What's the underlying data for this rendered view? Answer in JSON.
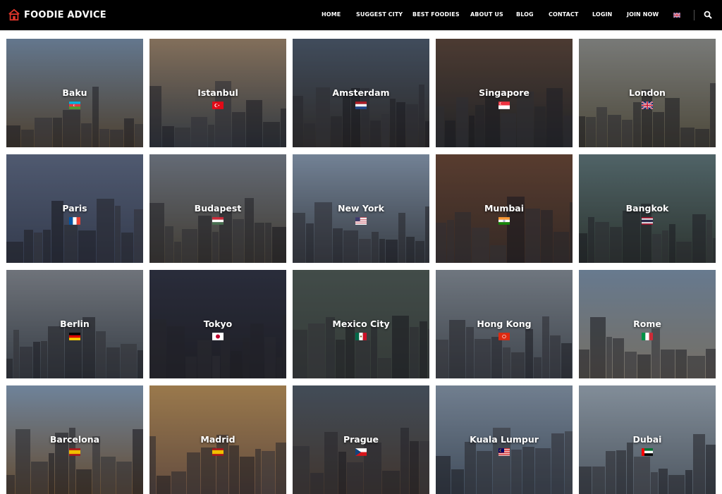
{
  "brand": {
    "name": "FOODIE ADVICE",
    "icon": "chef-house-icon",
    "color": "#e0362b"
  },
  "nav": {
    "items": [
      {
        "label": "HOME"
      },
      {
        "label": "SUGGEST CITY"
      },
      {
        "label": "BEST FOODIES"
      },
      {
        "label": "ABOUT US"
      },
      {
        "label": "BLOG"
      },
      {
        "label": "CONTACT"
      },
      {
        "label": "LOGIN"
      },
      {
        "label": "JOIN NOW"
      }
    ],
    "language_flag": "uk-flag-icon",
    "search_icon": "search-icon"
  },
  "cities": [
    {
      "name": "Baku",
      "flag": "azerbaijan"
    },
    {
      "name": "Istanbul",
      "flag": "turkey"
    },
    {
      "name": "Amsterdam",
      "flag": "netherlands"
    },
    {
      "name": "Singapore",
      "flag": "singapore"
    },
    {
      "name": "London",
      "flag": "uk"
    },
    {
      "name": "Paris",
      "flag": "france"
    },
    {
      "name": "Budapest",
      "flag": "hungary"
    },
    {
      "name": "New York",
      "flag": "usa"
    },
    {
      "name": "Mumbai",
      "flag": "india"
    },
    {
      "name": "Bangkok",
      "flag": "thailand"
    },
    {
      "name": "Berlin",
      "flag": "germany"
    },
    {
      "name": "Tokyo",
      "flag": "japan"
    },
    {
      "name": "Mexico City",
      "flag": "mexico"
    },
    {
      "name": "Hong Kong",
      "flag": "hongkong"
    },
    {
      "name": "Rome",
      "flag": "italy"
    },
    {
      "name": "Barcelona",
      "flag": "spain"
    },
    {
      "name": "Madrid",
      "flag": "spain"
    },
    {
      "name": "Prague",
      "flag": "czech"
    },
    {
      "name": "Kuala Lumpur",
      "flag": "malaysia"
    },
    {
      "name": "Dubai",
      "flag": "uae"
    }
  ]
}
